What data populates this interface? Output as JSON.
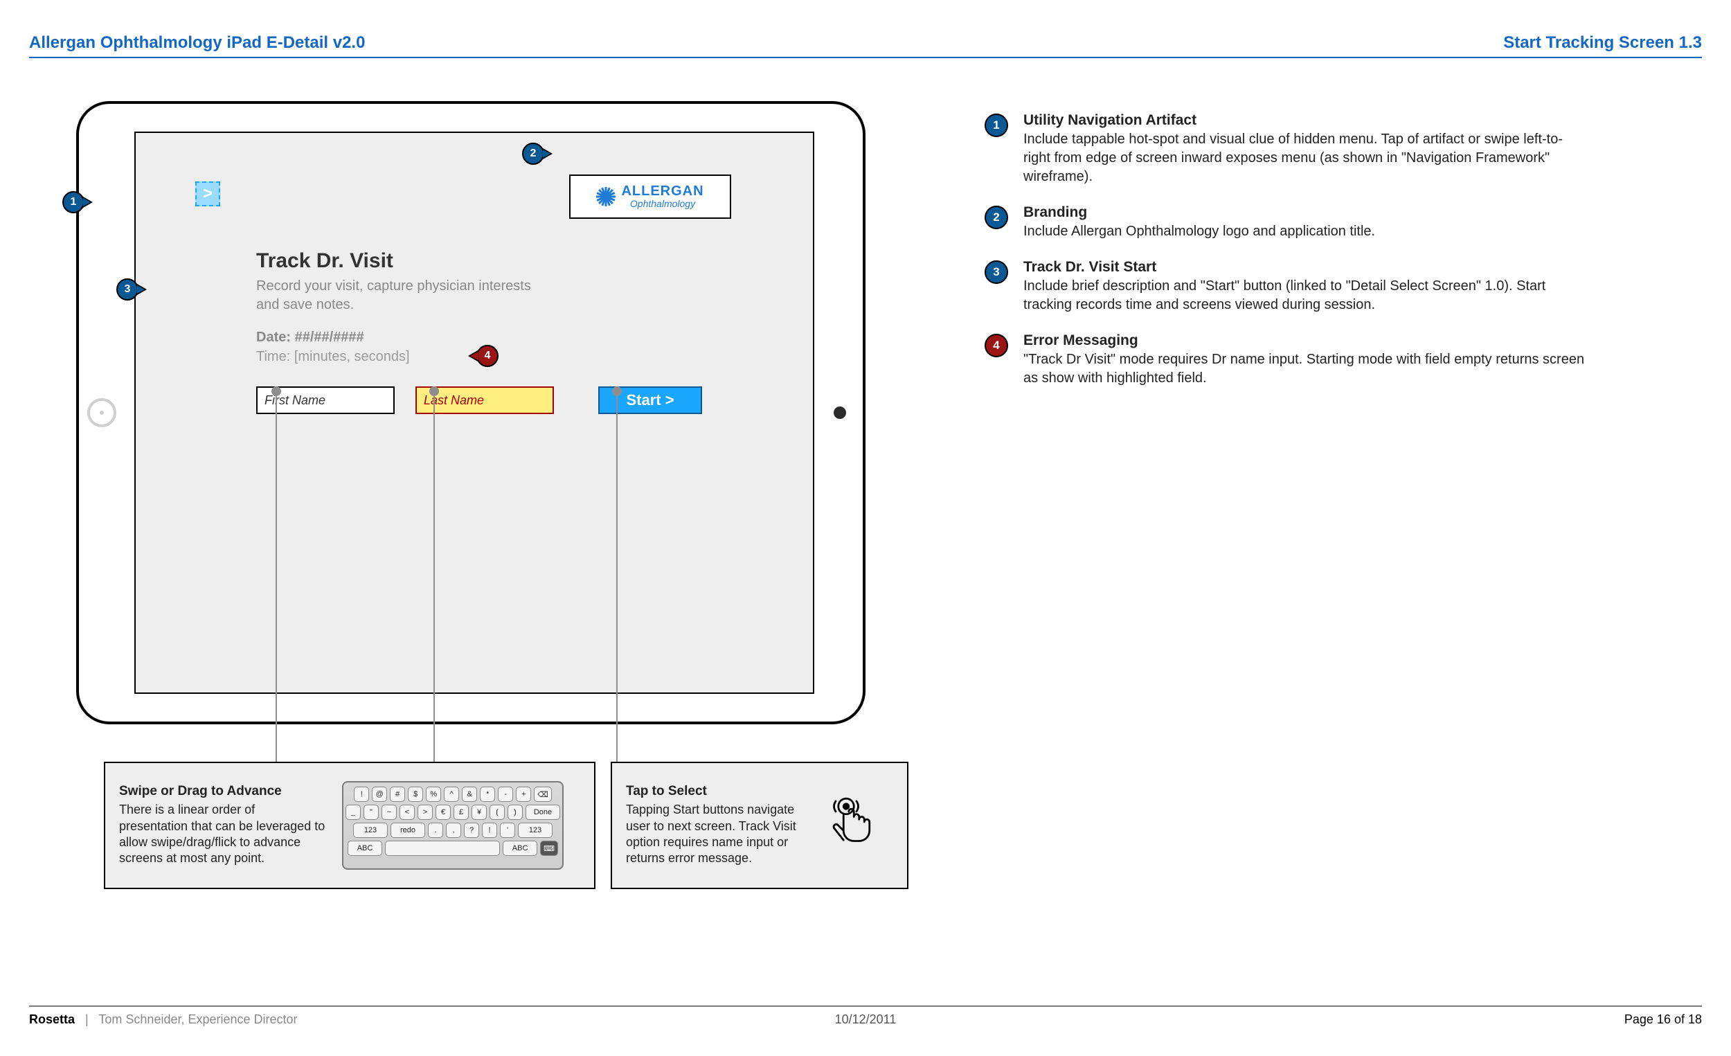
{
  "header": {
    "left": "Allergan Ophthalmology  iPad E-Detail v2.0",
    "right": "Start Tracking Screen 1.3"
  },
  "footer": {
    "brand": "Rosetta",
    "author": "Tom Schneider, Experience Director",
    "date": "10/12/2011",
    "page": "Page 16 of 18"
  },
  "device": {
    "nav_glyph": ">",
    "logo_line1": "ALLERGAN",
    "logo_line2": "Ophthalmology",
    "title": "Track Dr. Visit",
    "subtitle": "Record your visit, capture physician interests and save notes.",
    "date_label": "Date: ##/##/####",
    "time_label": "Time: [minutes, seconds]",
    "first_name_placeholder": "First Name",
    "last_name_placeholder": "Last Name",
    "start_label": "Start >"
  },
  "pins": {
    "p1": "1",
    "p2": "2",
    "p3": "3",
    "p4": "4"
  },
  "bottom_annos": {
    "a1_title": "Swipe or Drag to Advance",
    "a1_body": "There is a linear order of presentation that can be leveraged to allow swipe/drag/flick to advance screens at most any point.",
    "a2_title": "Tap to Select",
    "a2_body": "Tapping Start buttons navigate user to next screen. Track Visit option requires name input or returns error message."
  },
  "kbd": {
    "row1": [
      "!",
      "@",
      "#",
      "$",
      "%",
      "^",
      "&",
      "*",
      "-",
      "+",
      "⌫"
    ],
    "row2": [
      "_",
      "\"",
      "~",
      "<",
      ">",
      "€",
      "£",
      "¥",
      "(",
      ")",
      "Done"
    ],
    "row3": [
      "123",
      "redo",
      ".",
      ",",
      "?",
      "!",
      "'",
      "123"
    ],
    "row4": [
      "ABC",
      "",
      "ABC",
      "⌨"
    ]
  },
  "side_annos": [
    {
      "num": "1",
      "color": "blue",
      "title": "Utility Navigation Artifact",
      "body": "Include tappable hot-spot and visual clue of hidden menu. Tap of artifact or swipe left-to-right from edge of screen inward exposes menu (as shown in \"Navigation Framework\" wireframe)."
    },
    {
      "num": "2",
      "color": "blue",
      "title": "Branding",
      "body": "Include Allergan Ophthalmology  logo and application title."
    },
    {
      "num": "3",
      "color": "blue",
      "title": "Track Dr. Visit Start",
      "body": "Include brief description and \"Start\" button (linked to \"Detail Select Screen\" 1.0). Start tracking records time and screens viewed during session."
    },
    {
      "num": "4",
      "color": "red",
      "title": "Error Messaging",
      "body": "\"Track Dr Visit\" mode requires Dr name input. Starting mode with field empty returns screen as show with highlighted field."
    }
  ],
  "colors": {
    "header_blue": "#1368c6",
    "pin_blue": "#0a5894",
    "pin_red": "#9c1515",
    "accent_cyan": "#1aa6ff",
    "error_yellow": "#ffef80"
  }
}
